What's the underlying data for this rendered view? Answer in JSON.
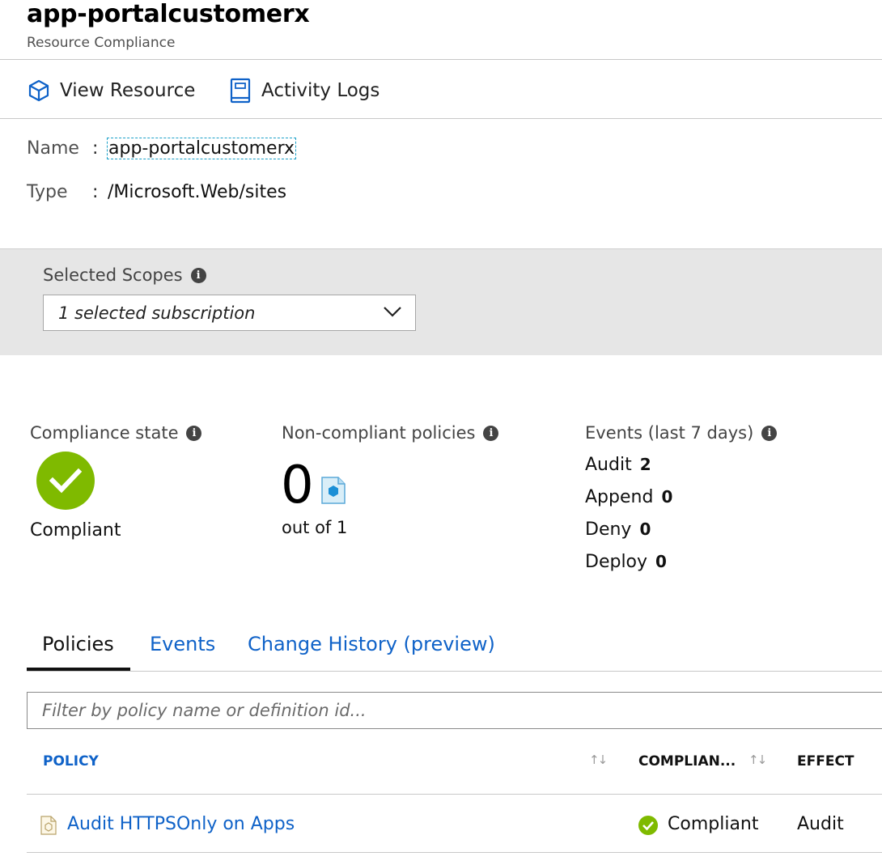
{
  "header": {
    "title": "app-portalcustomerx",
    "subtitle": "Resource Compliance"
  },
  "toolbar": {
    "view_resource": {
      "label": "View Resource",
      "icon": "cube-icon"
    },
    "activity_logs": {
      "label": "Activity Logs",
      "icon": "book-icon"
    }
  },
  "properties": {
    "name_key": "Name",
    "name_value": "app-portalcustomerx",
    "type_key": "Type",
    "type_value": "/Microsoft.Web/sites",
    "separator": ":"
  },
  "scope": {
    "label": "Selected Scopes",
    "selected": "1 selected subscription"
  },
  "metrics": {
    "compliance_state": {
      "label": "Compliance state",
      "value": "Compliant",
      "color": "#7fba00"
    },
    "non_compliant": {
      "label": "Non-compliant policies",
      "count": "0",
      "out_of": "out of 1"
    },
    "events": {
      "label": "Events (last 7 days)",
      "rows": [
        {
          "name": "Audit",
          "count": "2"
        },
        {
          "name": "Append",
          "count": "0"
        },
        {
          "name": "Deny",
          "count": "0"
        },
        {
          "name": "Deploy",
          "count": "0"
        }
      ]
    }
  },
  "tabs": [
    {
      "label": "Policies",
      "active": true
    },
    {
      "label": "Events",
      "active": false
    },
    {
      "label": "Change History (preview)",
      "active": false
    }
  ],
  "filter": {
    "placeholder": "Filter by policy name or definition id..."
  },
  "table": {
    "columns": [
      "POLICY",
      "COMPLIAN...",
      "EFFECT"
    ],
    "rows": [
      {
        "policy": "Audit HTTPSOnly on Apps",
        "compliance": "Compliant",
        "effect": "Audit"
      }
    ]
  },
  "colors": {
    "accent_blue": "#0f62c8",
    "compliant_green": "#7fba00"
  }
}
